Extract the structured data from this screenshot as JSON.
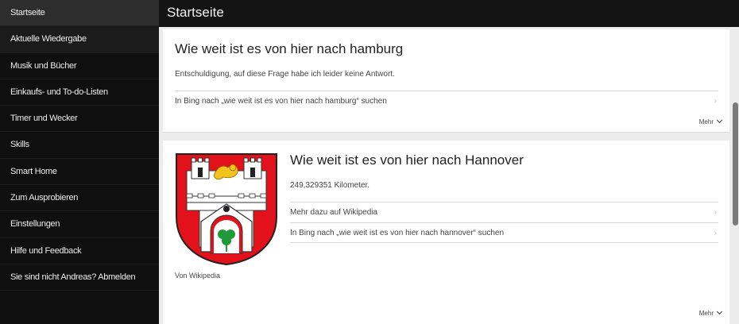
{
  "sidebar": {
    "items": [
      {
        "label": "Startseite"
      },
      {
        "label": "Aktuelle Wiedergabe"
      },
      {
        "label": "Musik und Bücher"
      },
      {
        "label": "Einkaufs- und To-do-Listen"
      },
      {
        "label": "Timer und Wecker"
      },
      {
        "label": "Skills"
      },
      {
        "label": "Smart Home"
      },
      {
        "label": "Zum Ausprobieren"
      },
      {
        "label": "Einstellungen"
      },
      {
        "label": "Hilfe und Feedback"
      },
      {
        "label": "Sie sind nicht Andreas? Abmelden"
      }
    ]
  },
  "header": {
    "title": "Startseite"
  },
  "cards": [
    {
      "title": "Wie weit ist es von hier nach hamburg",
      "text": "Entschuldigung, auf diese Frage habe ich leider keine Antwort.",
      "links": [
        "In Bing nach „wie weit ist es von hier nach hamburg“ suchen"
      ],
      "more": "Mehr"
    },
    {
      "title": "Wie weit ist es von hier nach Hannover",
      "text": "249,329351 Kilometer.",
      "links": [
        "Mehr dazu auf Wikipedia",
        "In Bing nach „wie weit ist es von hier nach hannover“ suchen"
      ],
      "image_caption": "Von Wikipedia",
      "more": "Mehr"
    }
  ],
  "colors": {
    "sidebar_bg": "#0f0f0f",
    "coat_red": "#e3111a",
    "coat_green": "#1f9a38",
    "lion_gold": "#f4c21c"
  }
}
